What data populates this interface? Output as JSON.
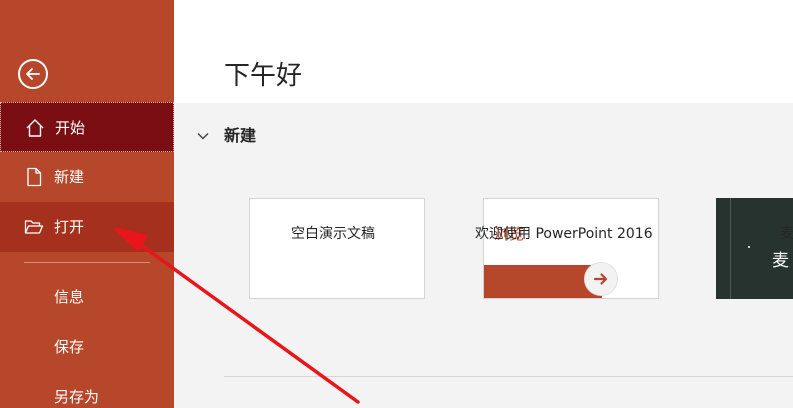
{
  "sidebar": {
    "back_icon": "back-arrow-icon",
    "items": [
      {
        "label": "开始",
        "icon": "home-icon",
        "state": "active"
      },
      {
        "label": "新建",
        "icon": "new-document-icon",
        "state": "normal"
      },
      {
        "label": "打开",
        "icon": "open-folder-icon",
        "state": "hover"
      },
      {
        "label": "信息"
      },
      {
        "label": "保存"
      },
      {
        "label": "另存为"
      }
    ]
  },
  "main": {
    "greeting": "下午好",
    "section_title": "新建",
    "templates": [
      {
        "label": "空白演示文稿"
      },
      {
        "label": "欢迎使用 PowerPoint 2016",
        "thumb_text": "浏览"
      },
      {
        "label": "麦",
        "thumb_text": "麦"
      }
    ]
  },
  "annotation": {
    "color": "#e8161b"
  },
  "colors": {
    "accent": "#b7472a",
    "active": "#7b0e13"
  }
}
